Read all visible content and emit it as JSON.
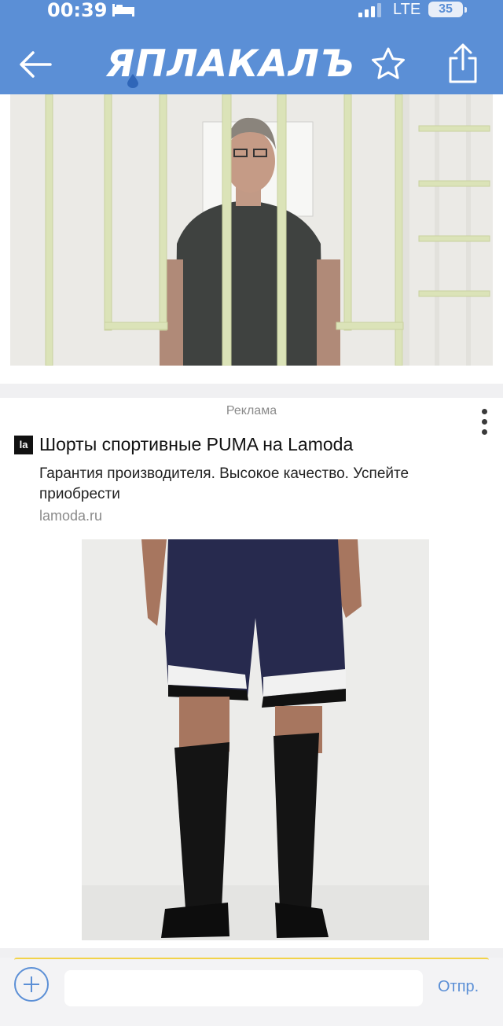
{
  "status_bar": {
    "time": "00:39",
    "network": "LTE",
    "battery": "35"
  },
  "nav": {
    "logo_text": "ЯПЛАКАЛЪ",
    "back_icon": "arrow-left-icon",
    "favorite_icon": "star-icon",
    "share_icon": "share-icon"
  },
  "post": {
    "photo": "man-behind-bars-photo"
  },
  "ad": {
    "label": "Реклама",
    "logo": "la",
    "title": "Шорты спортивные PUMA на Lamoda",
    "description": "Гарантия производителя. Высокое качество. Успейте приобрести",
    "domain": "lamoda.ru",
    "image": "sports-shorts-photo"
  },
  "comment": {
    "placeholder": "",
    "send_label": "Отпр."
  },
  "colors": {
    "accent": "#5b8fd6",
    "highlight": "#f2d34a"
  }
}
